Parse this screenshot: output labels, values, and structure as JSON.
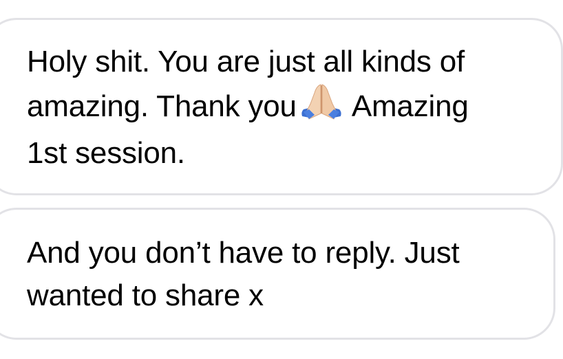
{
  "messages": [
    {
      "lines": [
        "Holy shit. You are just all kinds of",
        "amazing. Thank you",
        "Amazing",
        "1st session."
      ],
      "emoji": "folded-hands"
    },
    {
      "lines": [
        "And you don’t have to reply. Just",
        "wanted to share x"
      ]
    }
  ],
  "colors": {
    "bubble_border": "#e2e2e6",
    "text": "#000000",
    "background": "#ffffff"
  }
}
